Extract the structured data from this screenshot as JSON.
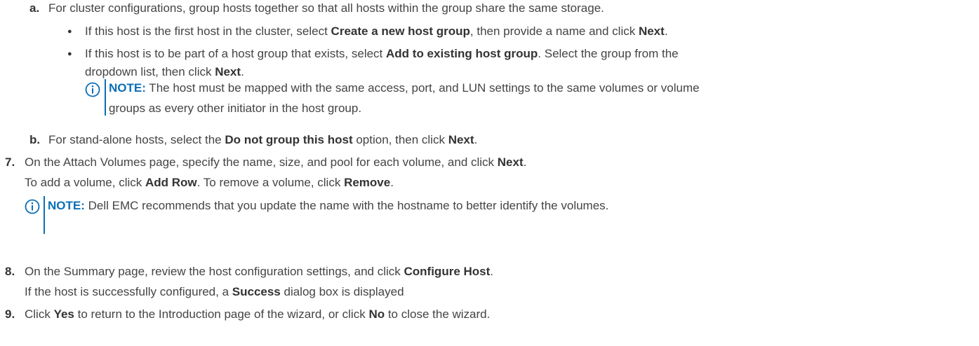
{
  "steps": {
    "a": {
      "marker": "a.",
      "text": "For cluster configurations, group hosts together so that all hosts within the group share the same storage.",
      "bullet1": {
        "t1": "If this host is the first host in the cluster, select ",
        "b1": "Create a new host group",
        "t2": ", then provide a name and click ",
        "b2": "Next",
        "t3": "."
      },
      "bullet2": {
        "t1": "If this host is to be part of a host group that exists, select ",
        "b1": "Add to existing host group",
        "t2": ". Select the group from the",
        "line2_t1": "dropdown list, then click ",
        "line2_b1": "Next",
        "line2_t2": "."
      },
      "note": {
        "label": "NOTE:",
        "text1": " The host must be mapped with the same access, port, and LUN settings to the same volumes or volume",
        "text2": "groups as every other initiator in the host group."
      }
    },
    "b": {
      "marker": "b.",
      "t1": "For stand-alone hosts, select the ",
      "b1": "Do not group this host",
      "t2": " option, then click ",
      "b2": "Next",
      "t3": "."
    },
    "s7": {
      "marker": "7.",
      "t1": "On the Attach Volumes page, specify the name, size, and pool for each volume, and click ",
      "b1": "Next",
      "t2": ".",
      "sub_t1": "To add a volume, click ",
      "sub_b1": "Add Row",
      "sub_t2": ". To remove a volume, click ",
      "sub_b2": "Remove",
      "sub_t3": ".",
      "note": {
        "label": "NOTE:",
        "text": " Dell EMC recommends that you update the name with the hostname to better identify the volumes."
      }
    },
    "s8": {
      "marker": "8.",
      "t1": "On the Summary page, review the host configuration settings, and click ",
      "b1": "Configure Host",
      "t2": ".",
      "sub_t1": "If the host is successfully configured, a ",
      "sub_b1": "Success",
      "sub_t2": " dialog box is displayed"
    },
    "s9": {
      "marker": "9.",
      "t1": "Click ",
      "b1": "Yes",
      "t2": " to return to the Introduction page of the wizard, or click ",
      "b2": "No",
      "t3": " to close the wizard."
    }
  },
  "icons": {
    "note_icon": "info-circle-icon",
    "note_color": "#0b6fb6"
  }
}
